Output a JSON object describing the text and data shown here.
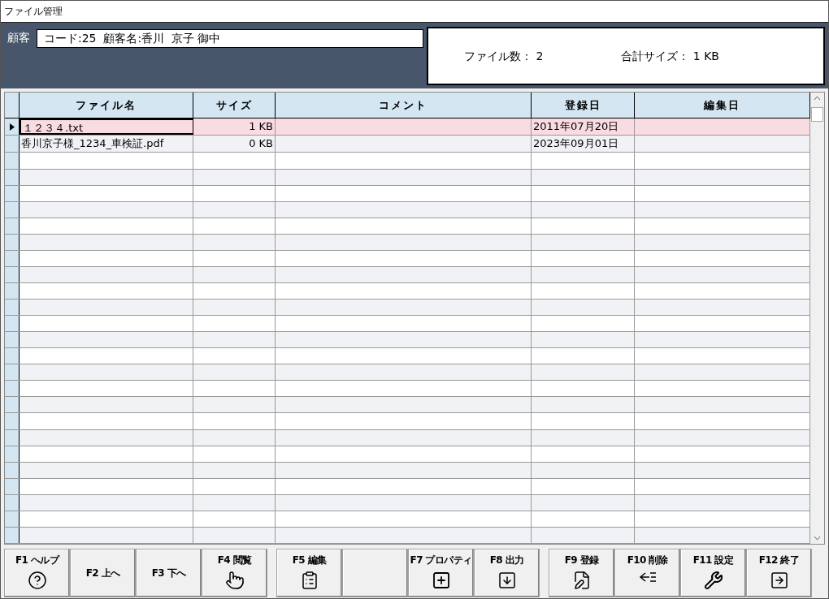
{
  "window": {
    "title": "ファイル管理"
  },
  "customer": {
    "label": "顧客",
    "value": "コード:25  顧客名:香川  京子 御中"
  },
  "summary": {
    "file_count": "ファイル数： 2",
    "total_size": "合計サイズ： 1 KB"
  },
  "table": {
    "columns": [
      "ファイル名",
      "サイズ",
      "コメント",
      "登録日",
      "編集日"
    ],
    "rows": [
      {
        "selected": true,
        "cells": [
          "１２３４.txt",
          "1 KB",
          "",
          "2011年07月20日",
          ""
        ]
      },
      {
        "selected": false,
        "cells": [
          "香川京子様_1234_車検証.pdf",
          "0 KB",
          "",
          "2023年09月01日",
          ""
        ]
      }
    ]
  },
  "button_groups": [
    [
      {
        "kind": "help",
        "label": "F1 ヘルプ"
      },
      {
        "kind": "text",
        "label": "F2 上へ"
      },
      {
        "kind": "text",
        "label": "F3 下へ"
      },
      {
        "kind": "ok",
        "label": "F4 閲覧"
      }
    ],
    [
      {
        "kind": "clipboard",
        "label": "F5 編集"
      },
      {
        "kind": "blank"
      },
      {
        "kind": "plus",
        "label": "F7 プロパティ"
      },
      {
        "kind": "download",
        "label": "F8 出力"
      }
    ],
    [
      {
        "kind": "file-edit",
        "label": "F9 登録"
      },
      {
        "kind": "delete",
        "label": "F10 削除"
      },
      {
        "kind": "tools",
        "label": "F11 設定"
      },
      {
        "kind": "exit",
        "label": "F12 終了"
      }
    ]
  ]
}
